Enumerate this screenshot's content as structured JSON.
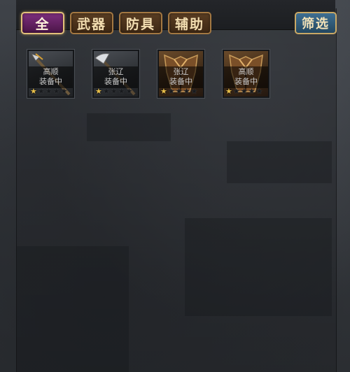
{
  "tabs": [
    {
      "label": "全",
      "active": true
    },
    {
      "label": "武器",
      "active": false
    },
    {
      "label": "防具",
      "active": false
    },
    {
      "label": "辅助",
      "active": false
    }
  ],
  "filter_label": "筛选",
  "items": [
    {
      "hero": "高顺",
      "status": "装备中",
      "type": "spear",
      "stars_filled": 1,
      "stars_total": 5
    },
    {
      "hero": "张辽",
      "status": "装备中",
      "type": "blade",
      "stars_filled": 1,
      "stars_total": 5
    },
    {
      "hero": "张辽",
      "status": "装备中",
      "type": "armor",
      "stars_filled": 1,
      "stars_total": 5
    },
    {
      "hero": "高顺",
      "status": "装备中",
      "type": "armor",
      "stars_filled": 1,
      "stars_total": 5
    }
  ]
}
